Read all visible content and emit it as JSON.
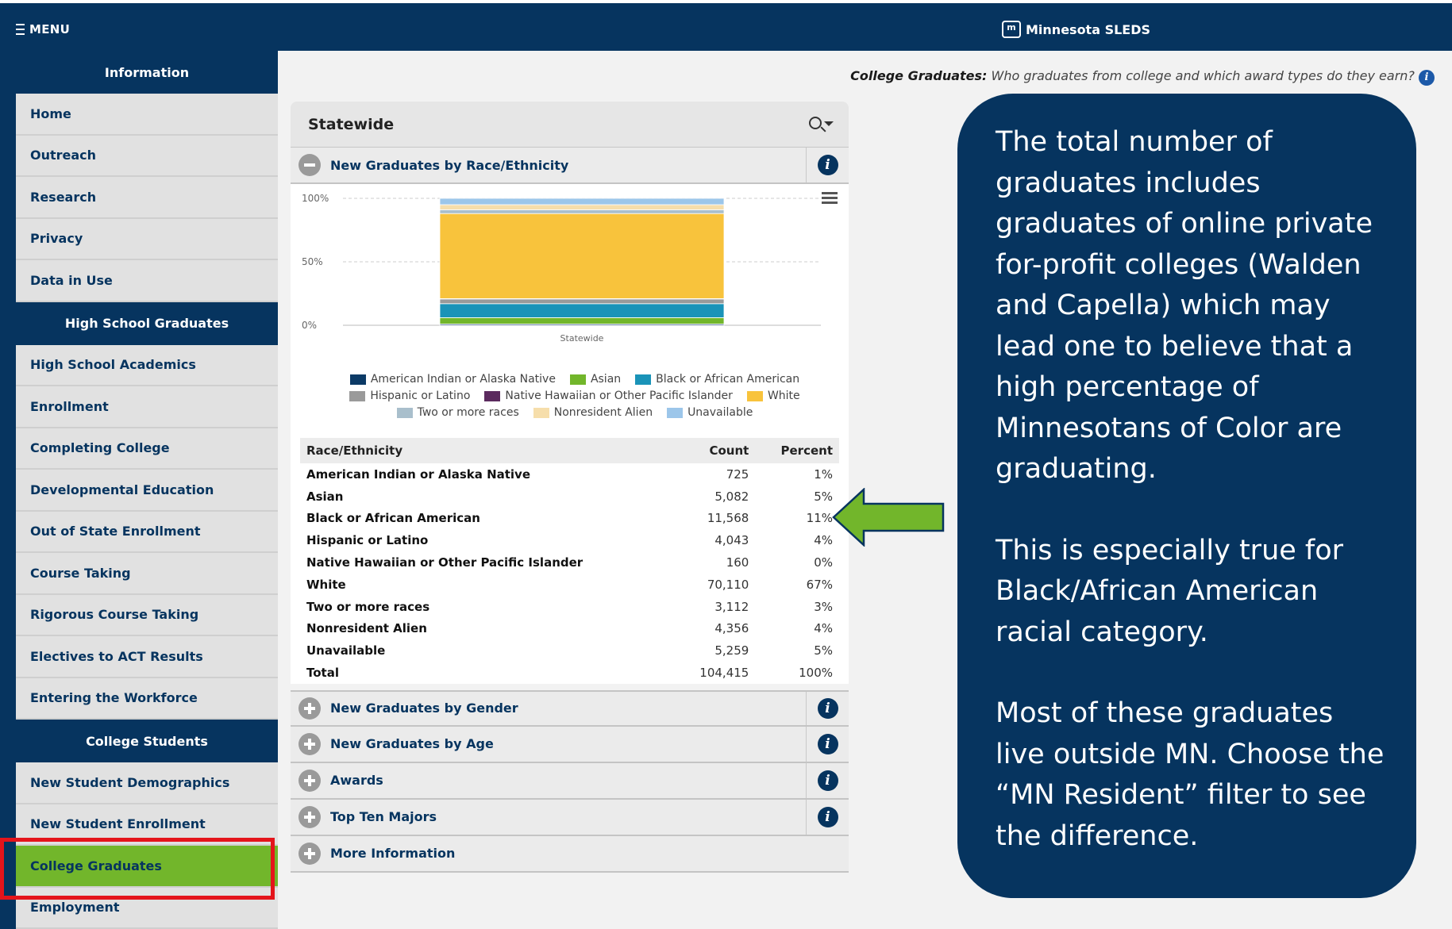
{
  "header": {
    "menu_label": "MENU",
    "brand_logo": "m",
    "brand": "Minnesota SLEDS"
  },
  "sidebar": {
    "sections": [
      {
        "title": "Information",
        "items": [
          "Home",
          "Outreach",
          "Research",
          "Privacy",
          "Data in Use"
        ]
      },
      {
        "title": "High School Graduates",
        "items": [
          "High School Academics",
          "Enrollment",
          "Completing College",
          "Developmental Education",
          "Out of State Enrollment",
          "Course Taking",
          "Rigorous Course Taking",
          "Electives to ACT Results",
          "Entering the Workforce"
        ]
      },
      {
        "title": "College Students",
        "items": [
          "New Student Demographics",
          "New Student Enrollment",
          "College Graduates",
          "Employment"
        ]
      }
    ],
    "active_item": "College Graduates"
  },
  "page": {
    "subtitle_label": "College Graduates:",
    "subtitle_text": "Who graduates from college and which award types do they earn?",
    "info_glyph": "i"
  },
  "panel": {
    "title": "Statewide",
    "sections": {
      "race": "New Graduates by Race/Ethnicity",
      "gender": "New Graduates by Gender",
      "age": "New Graduates by Age",
      "awards": "Awards",
      "majors": "Top Ten Majors",
      "more": "More Information"
    }
  },
  "chart_data": {
    "type": "bar",
    "stacked": true,
    "categories": [
      "Statewide"
    ],
    "y_ticks": [
      "100%",
      "50%",
      "0%"
    ],
    "ylim": [
      0,
      100
    ],
    "grid": true,
    "legend_position": "bottom",
    "series": [
      {
        "name": "American Indian or Alaska Native",
        "color": "#0b3a66",
        "values": [
          1
        ]
      },
      {
        "name": "Asian",
        "color": "#72b62b",
        "values": [
          5
        ]
      },
      {
        "name": "Black or African American",
        "color": "#1a93b8",
        "values": [
          11
        ]
      },
      {
        "name": "Hispanic or Latino",
        "color": "#9a9a9a",
        "values": [
          4
        ]
      },
      {
        "name": "Native Hawaiian or Other Pacific Islander",
        "color": "#5b2a5e",
        "values": [
          0
        ]
      },
      {
        "name": "White",
        "color": "#f8c33c",
        "values": [
          67
        ]
      },
      {
        "name": "Two or more races",
        "color": "#a9bfcc",
        "values": [
          3
        ]
      },
      {
        "name": "Nonresident Alien",
        "color": "#f6deab",
        "values": [
          4
        ]
      },
      {
        "name": "Unavailable",
        "color": "#9cc6ea",
        "values": [
          5
        ]
      }
    ]
  },
  "table": {
    "headers": [
      "Race/Ethnicity",
      "Count",
      "Percent"
    ],
    "rows": [
      [
        "American Indian or Alaska Native",
        "725",
        "1%"
      ],
      [
        "Asian",
        "5,082",
        "5%"
      ],
      [
        "Black or African American",
        "11,568",
        "11%"
      ],
      [
        "Hispanic or Latino",
        "4,043",
        "4%"
      ],
      [
        "Native Hawaiian or Other Pacific Islander",
        "160",
        "0%"
      ],
      [
        "White",
        "70,110",
        "67%"
      ],
      [
        "Two or more races",
        "3,112",
        "3%"
      ],
      [
        "Nonresident Alien",
        "4,356",
        "4%"
      ],
      [
        "Unavailable",
        "5,259",
        "5%"
      ],
      [
        "Total",
        "104,415",
        "100%"
      ]
    ]
  },
  "callout": {
    "p1": "The total number of graduates includes graduates of online private for-profit colleges (Walden and Capella) which may lead one to believe that a high percentage of Minnesotans of Color are graduating.",
    "p2": "This is especially true for Black/African American racial category.",
    "p3": "Most of these graduates live outside MN. Choose the “MN Resident” filter to see the difference."
  },
  "colors": {
    "navy": "#06345f",
    "active_green": "#72b62b",
    "highlight_red": "#e4141b",
    "arrow_green": "#72b62b"
  }
}
